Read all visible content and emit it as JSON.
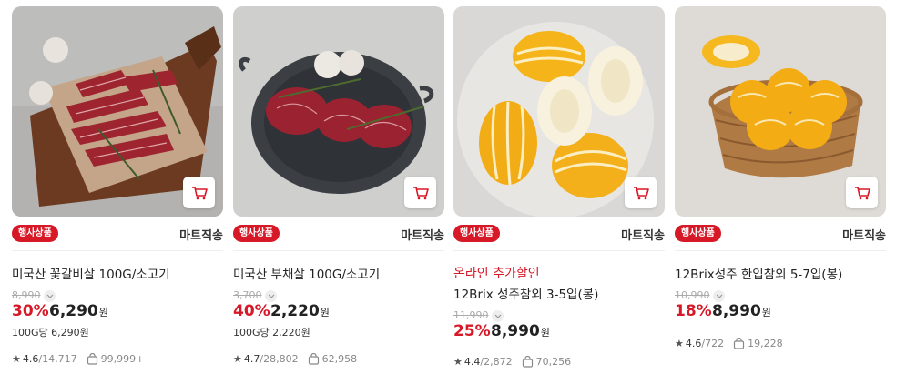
{
  "products": [
    {
      "badge": "행사상품",
      "delivery": "마트직송",
      "promo": "",
      "name": "미국산 꽃갈비살 100G/소고기",
      "original_price": "8,990",
      "discount": "30%",
      "price": "6,290",
      "won": "원",
      "unit_price": "100G당 6,290원",
      "rating": "4.6",
      "reviews": "14,717",
      "purchases": "99,999+"
    },
    {
      "badge": "행사상품",
      "delivery": "마트직송",
      "promo": "",
      "name": "미국산 부채살 100G/소고기",
      "original_price": "3,700",
      "discount": "40%",
      "price": "2,220",
      "won": "원",
      "unit_price": "100G당 2,220원",
      "rating": "4.7",
      "reviews": "28,802",
      "purchases": "62,958"
    },
    {
      "badge": "행사상품",
      "delivery": "마트직송",
      "promo": "온라인 추가할인",
      "name": "12Brix 성주참외 3-5입(봉)",
      "original_price": "11,990",
      "discount": "25%",
      "price": "8,990",
      "won": "원",
      "unit_price": "",
      "rating": "4.4",
      "reviews": "2,872",
      "purchases": "70,256"
    },
    {
      "badge": "행사상품",
      "delivery": "마트직송",
      "promo": "",
      "name": "12Brix성주 한입참외 5-7입(봉)",
      "original_price": "10,990",
      "discount": "18%",
      "price": "8,990",
      "won": "원",
      "unit_price": "",
      "rating": "4.6",
      "reviews": "722",
      "purchases": "19,228"
    }
  ],
  "colors": {
    "accent": "#d71826",
    "muted": "#888888"
  },
  "icons": {
    "cart": "cart-icon",
    "star": "star-icon",
    "purchase": "purchase-bag-icon",
    "chevron": "chevron-down-icon"
  }
}
